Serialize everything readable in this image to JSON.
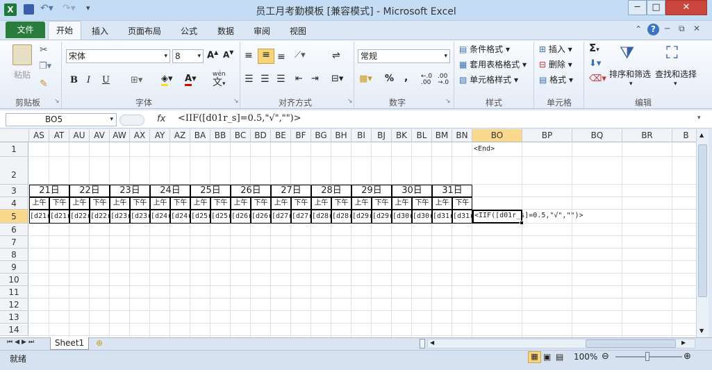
{
  "window": {
    "title": "员工月考勤模板 [兼容模式] - Microsoft Excel",
    "minimize": "─",
    "maximize": "□",
    "close": "✕"
  },
  "tabs": {
    "file": "文件",
    "home": "开始",
    "insert": "插入",
    "layout": "页面布局",
    "formulas": "公式",
    "data": "数据",
    "review": "审阅",
    "view": "视图"
  },
  "ribbon": {
    "clipboard": {
      "paste": "粘贴",
      "label": "剪贴板"
    },
    "font": {
      "name": "宋体",
      "size": "8",
      "bold": "B",
      "italic": "I",
      "underline": "U",
      "label": "字体",
      "wen": "wén"
    },
    "alignment": {
      "label": "对齐方式"
    },
    "number": {
      "format": "常规",
      "label": "数字",
      "percent": "%",
      "comma": ","
    },
    "styles": {
      "conditional": "条件格式",
      "table": "套用表格格式",
      "cell": "单元格样式",
      "label": "样式"
    },
    "cells": {
      "insert": "插入",
      "delete": "删除",
      "format": "格式",
      "label": "单元格"
    },
    "editing": {
      "sort": "排序和筛选",
      "find": "查找和选择",
      "label": "编辑",
      "sigma": "Σ"
    }
  },
  "formula_bar": {
    "name_box": "BO5",
    "fx": "fx",
    "formula": "<IIF([d01r_s]=0.5,\"√\",\"\")>"
  },
  "columns": [
    "AS",
    "AT",
    "AU",
    "AV",
    "AW",
    "AX",
    "AY",
    "AZ",
    "BA",
    "BB",
    "BC",
    "BD",
    "BE",
    "BF",
    "BG",
    "BH",
    "BI",
    "BJ",
    "BK",
    "BL",
    "BM",
    "BN",
    "BO",
    "BP",
    "BQ",
    "BR",
    "B"
  ],
  "rows": [
    "1",
    "2",
    "3",
    "4",
    "5",
    "6",
    "7",
    "8",
    "9",
    "10",
    "11",
    "12",
    "13",
    "14"
  ],
  "cells": {
    "bo1": "<End>",
    "days": [
      "21日",
      "22日",
      "23日",
      "24日",
      "25日",
      "26日",
      "27日",
      "28日",
      "29日",
      "30日",
      "31日"
    ],
    "am": "上午",
    "pm": "下午",
    "row5": [
      "[d21r",
      "[d21r",
      "[d22r",
      "[d22r",
      "[d23r",
      "[d23r",
      "[d24r",
      "[d24r",
      "[d25r",
      "[d25r",
      "[d26r",
      "[d26r",
      "[d27r",
      "[d27r",
      "[d28r",
      "[d28r",
      "[d29r",
      "[d29r",
      "[d30r",
      "[d30r",
      "[d31r",
      "[d31r"
    ],
    "bo5": "<IIF([d01r_s]=0.5,\"√\",\"\")>"
  },
  "sheets": {
    "sheet1": "Sheet1"
  },
  "status": {
    "ready": "就绪",
    "zoom": "100%"
  }
}
